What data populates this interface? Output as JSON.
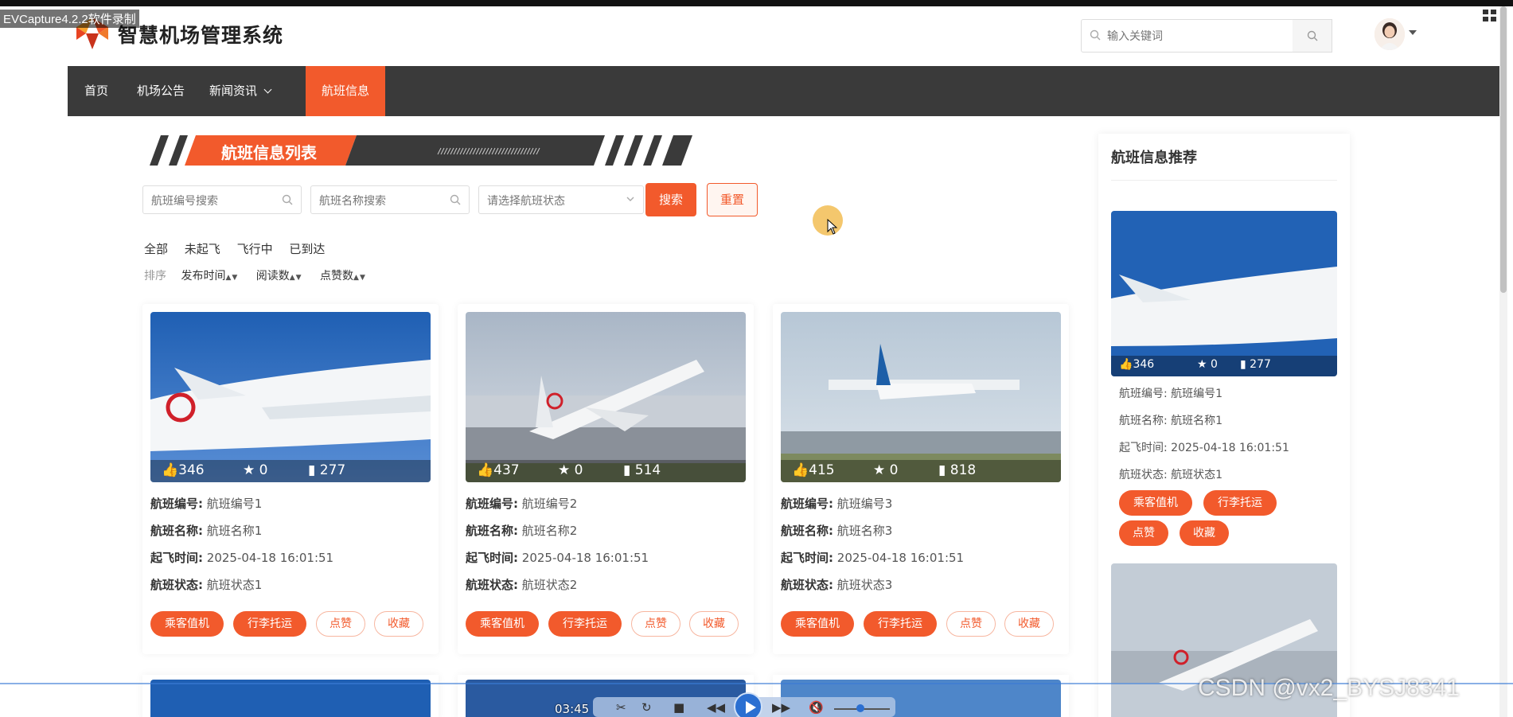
{
  "recorder": {
    "title": "EVCapture4.2.2软件录制",
    "time": "03:45",
    "watermark": "CSDN @vx2_BYSJ8341"
  },
  "header": {
    "site_title": "智慧机场管理系统",
    "search_placeholder": "输入关键词"
  },
  "nav": {
    "items": [
      {
        "label": "首页"
      },
      {
        "label": "机场公告"
      },
      {
        "label": "新闻资讯"
      },
      {
        "label": "航班信息"
      }
    ]
  },
  "page": {
    "banner_title": "航班信息列表"
  },
  "filters": {
    "flight_no_placeholder": "航班编号搜索",
    "flight_name_placeholder": "航班名称搜索",
    "status_placeholder": "请选择航班状态",
    "search_label": "搜索",
    "reset_label": "重置"
  },
  "status_tabs": [
    "全部",
    "未起飞",
    "飞行中",
    "已到达"
  ],
  "sort": {
    "label": "排序",
    "items": [
      "发布时间",
      "阅读数",
      "点赞数"
    ]
  },
  "labels": {
    "flight_no": "航班编号:",
    "flight_name": "航班名称:",
    "takeoff": "起飞时间:",
    "status": "航班状态:"
  },
  "actions": [
    "乘客值机",
    "行李托运",
    "点赞",
    "收藏"
  ],
  "cards": [
    {
      "likes": "346",
      "stars": "0",
      "reads": "277",
      "flight_no": "航班编号1",
      "flight_name": "航班名称1",
      "takeoff": "2025-04-18 16:01:51",
      "status": "航班状态1"
    },
    {
      "likes": "437",
      "stars": "0",
      "reads": "514",
      "flight_no": "航班编号2",
      "flight_name": "航班名称2",
      "takeoff": "2025-04-18 16:01:51",
      "status": "航班状态2"
    },
    {
      "likes": "415",
      "stars": "0",
      "reads": "818",
      "flight_no": "航班编号3",
      "flight_name": "航班名称3",
      "takeoff": "2025-04-18 16:01:51",
      "status": "航班状态3"
    }
  ],
  "sidebar": {
    "title": "航班信息推荐",
    "item": {
      "likes": "346",
      "stars": "0",
      "reads": "277",
      "flight_no": "航班编号1",
      "flight_name": "航班名称1",
      "takeoff": "2025-04-18 16:01:51",
      "status": "航班状态1"
    }
  }
}
